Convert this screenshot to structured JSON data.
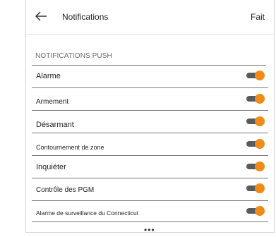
{
  "header": {
    "title": "Notifications",
    "done_label": "Fait"
  },
  "section": {
    "label": "NOTIFICATIONS PUSH"
  },
  "items": [
    {
      "label": "Alarme",
      "enabled": true
    },
    {
      "label": "Armement",
      "enabled": true
    },
    {
      "label": "Désarmant",
      "enabled": true
    },
    {
      "label": "Contournement de zone",
      "enabled": true
    },
    {
      "label": "Inquiéter",
      "enabled": true
    },
    {
      "label": "Contrôle des PGM",
      "enabled": true
    },
    {
      "label": "Alarme de surveillance du Connecticut",
      "enabled": true
    }
  ],
  "footer": {
    "more_indicator": "•••"
  },
  "colors": {
    "toggle_knob": "#f08a18",
    "toggle_track": "#5a5a5a"
  }
}
